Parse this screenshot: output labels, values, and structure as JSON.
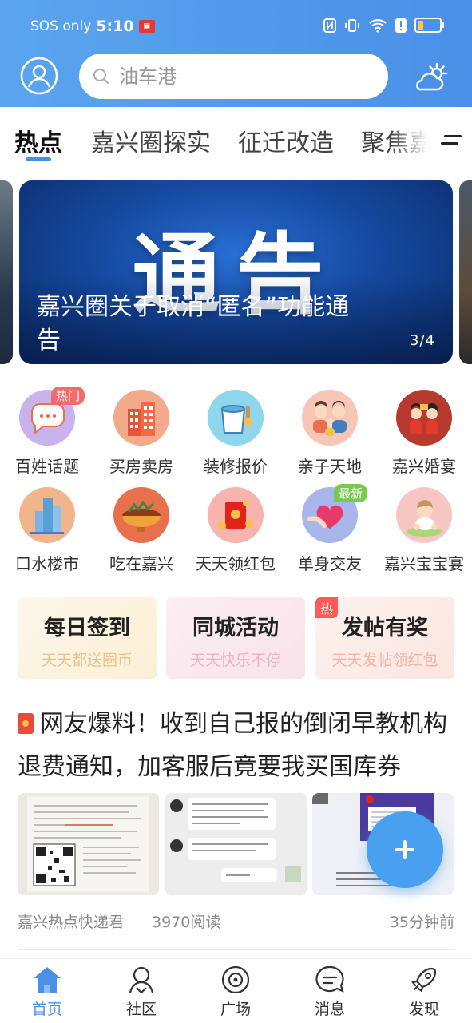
{
  "status_bar": {
    "carrier": "SOS only",
    "time": "5:10",
    "battery_level": 0.3
  },
  "header": {
    "search_placeholder": "油车港"
  },
  "tabs": [
    {
      "label": "热点",
      "active": true
    },
    {
      "label": "嘉兴圈探实"
    },
    {
      "label": "征迁改造"
    },
    {
      "label": "聚焦嘉"
    }
  ],
  "banner": {
    "image_text": "通告",
    "title": "嘉兴圈关于取消“匿名”功能通告",
    "counter": "3/4"
  },
  "grid": [
    {
      "label": "百姓话题",
      "badge": "热门"
    },
    {
      "label": "买房卖房"
    },
    {
      "label": "装修报价"
    },
    {
      "label": "亲子天地"
    },
    {
      "label": "嘉兴婚宴"
    },
    {
      "label": "口水楼市"
    },
    {
      "label": "吃在嘉兴"
    },
    {
      "label": "天天领红包"
    },
    {
      "label": "单身交友",
      "badge": "最新"
    },
    {
      "label": "嘉兴宝宝宴"
    }
  ],
  "cards": [
    {
      "title": "每日签到",
      "subtitle": "天天都送圈币"
    },
    {
      "title": "同城活动",
      "subtitle": "天天快乐不停"
    },
    {
      "title": "发帖有奖",
      "subtitle": "天天发帖领红包",
      "tag": "热"
    }
  ],
  "article": {
    "title": "网友爆料！收到自己报的倒闭早教机构退费通知，加客服后竟要我买国库券",
    "author": "嘉兴热点快递君",
    "views": "3970阅读",
    "time": "35分钟前"
  },
  "bottom_nav": [
    {
      "label": "首页",
      "active": true
    },
    {
      "label": "社区"
    },
    {
      "label": "广场"
    },
    {
      "label": "消息"
    },
    {
      "label": "发现"
    }
  ],
  "colors": {
    "primary": "#4a90e8",
    "accent_red": "#f46a6a"
  }
}
